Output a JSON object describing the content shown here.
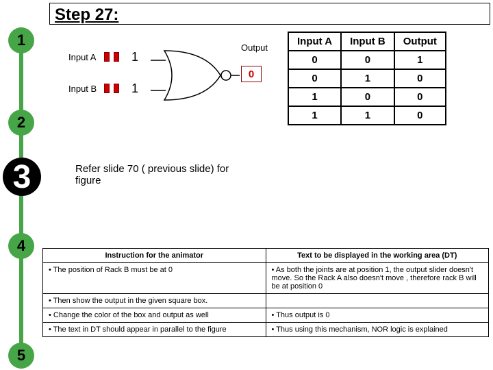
{
  "step_title": "Step 27:",
  "inputs": {
    "a_label": "Input A",
    "b_label": "Input B",
    "a_bit": "1",
    "b_bit": "1"
  },
  "gate": {
    "output_label": "Output",
    "output_value": "0"
  },
  "truth": {
    "headers": [
      "Input A",
      "Input B",
      "Output"
    ],
    "rows": [
      [
        "0",
        "0",
        "1"
      ],
      [
        "0",
        "1",
        "0"
      ],
      [
        "1",
        "0",
        "0"
      ],
      [
        "1",
        "1",
        "0"
      ]
    ]
  },
  "refer_text": "Refer slide 70 ( previous slide) for figure",
  "bullets": {
    "b1": "1",
    "b2": "2",
    "b3": "3",
    "b4": "4",
    "b5": "5"
  },
  "bottom": {
    "head_left": "Instruction for the animator",
    "head_right": "Text to be displayed in the working area (DT)",
    "rows": [
      {
        "l": "The position of Rack B must be at 0",
        "r": "As both the joints are at position 1, the output slider doesn't move. So the Rack A also doesn't move , therefore rack B will be at position 0"
      },
      {
        "l": "Then show the output in the given square box.",
        "r": ""
      },
      {
        "l": "Change the color of the box and output as well",
        "r": "Thus output is 0"
      },
      {
        "l": "The text in DT should appear  in parallel to the figure",
        "r": "Thus using this mechanism, NOR logic is explained"
      }
    ]
  },
  "chart_data": {
    "type": "table",
    "title": "NOR gate truth table",
    "columns": [
      "Input A",
      "Input B",
      "Output"
    ],
    "rows": [
      [
        0,
        0,
        1
      ],
      [
        0,
        1,
        0
      ],
      [
        1,
        0,
        0
      ],
      [
        1,
        1,
        0
      ]
    ]
  }
}
